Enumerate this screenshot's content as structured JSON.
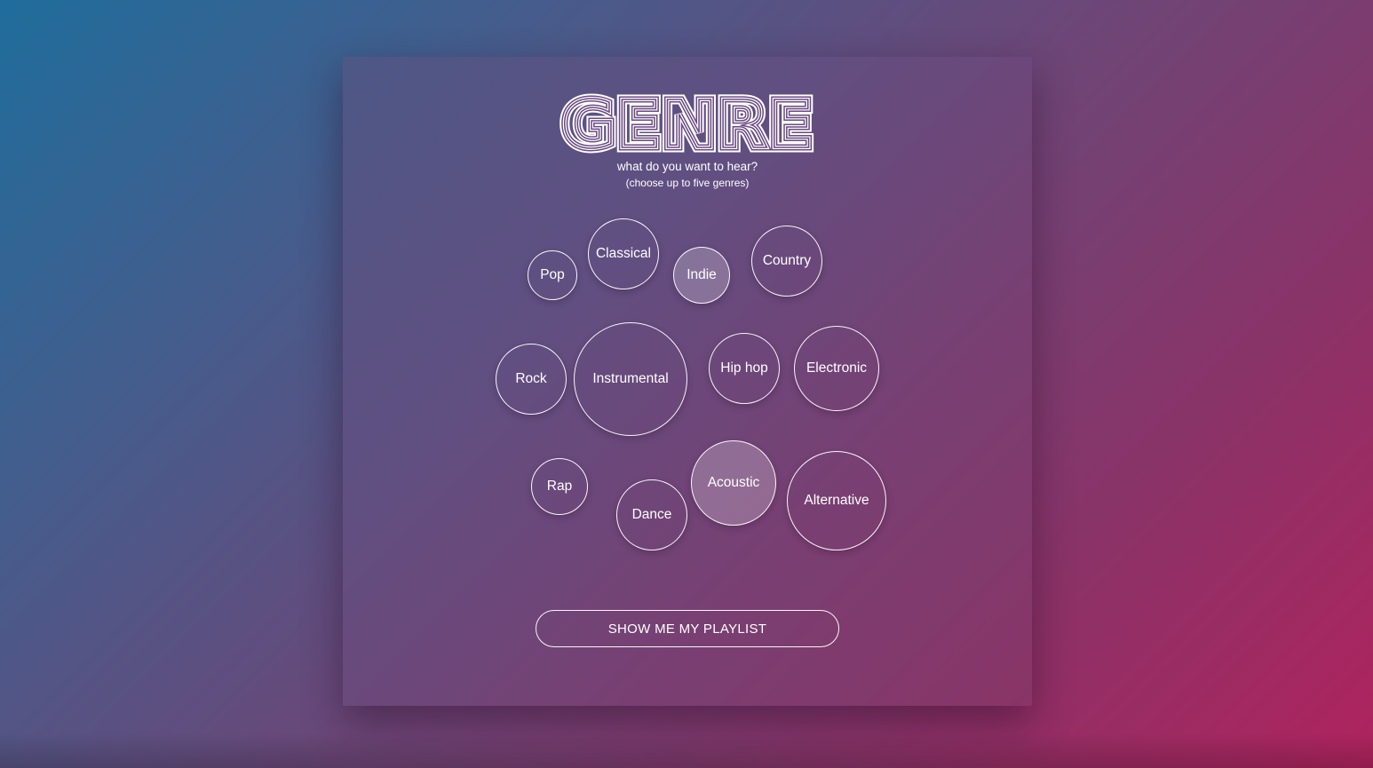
{
  "header": {
    "logo_text": "GENRE",
    "subtitle": "what do you want to hear?",
    "hint": "(choose up to five genres)"
  },
  "genres": [
    {
      "label": "Pop",
      "selected": false
    },
    {
      "label": "Classical",
      "selected": false
    },
    {
      "label": "Indie",
      "selected": true
    },
    {
      "label": "Country",
      "selected": false
    },
    {
      "label": "Rock",
      "selected": false
    },
    {
      "label": "Instrumental",
      "selected": false
    },
    {
      "label": "Hip hop",
      "selected": false
    },
    {
      "label": "Electronic",
      "selected": false
    },
    {
      "label": "Rap",
      "selected": false
    },
    {
      "label": "Dance",
      "selected": false
    },
    {
      "label": "Acoustic",
      "selected": true
    },
    {
      "label": "Alternative",
      "selected": false
    }
  ],
  "action": {
    "button_label": "SHOW ME MY PLAYLIST"
  }
}
